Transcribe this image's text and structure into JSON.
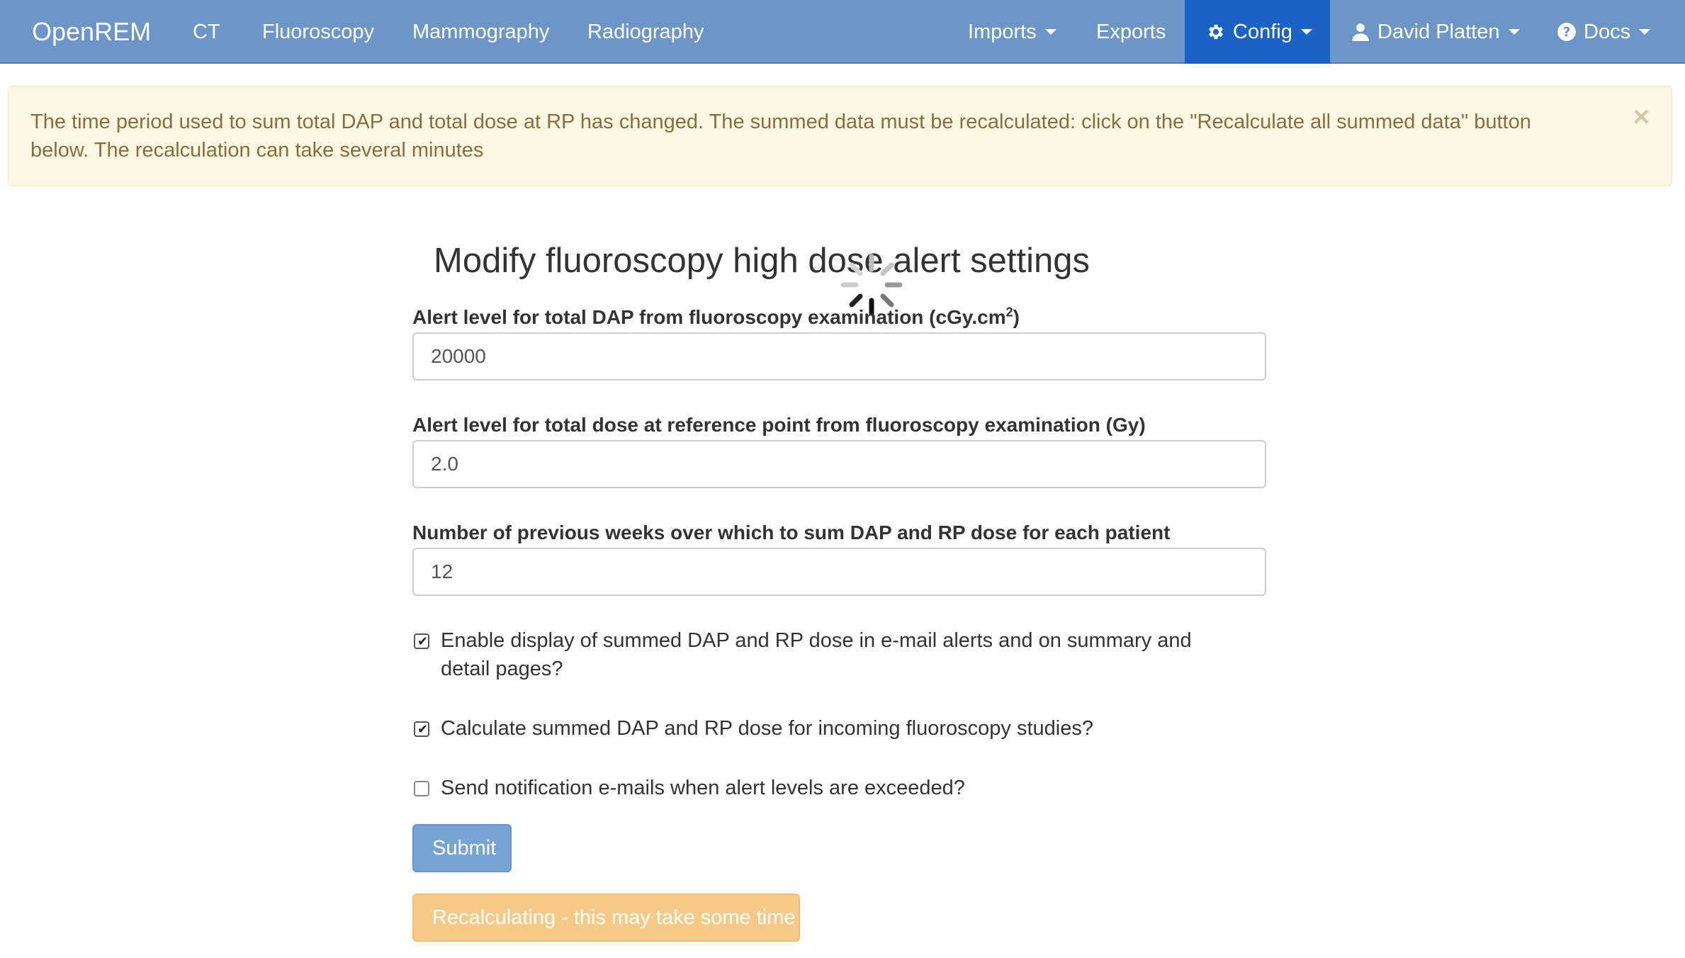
{
  "navbar": {
    "brand": "OpenREM",
    "links": {
      "ct": "CT",
      "fluoroscopy": "Fluoroscopy",
      "mammography": "Mammography",
      "radiography": "Radiography",
      "imports": "Imports",
      "exports": "Exports",
      "config": "Config",
      "user": "David Platten",
      "docs": "Docs"
    },
    "active_item": "Config",
    "colors": {
      "bar": "#6c95c8",
      "active": "#1a62c6"
    }
  },
  "alert": {
    "message": "The time period used to sum total DAP and total dose at RP has changed. The summed data must be recalculated: click on the \"Recalculate all summed data\" button below. The recalculation can take several minutes",
    "close_label": "×"
  },
  "form": {
    "title": "Modify fluoroscopy high dose alert settings",
    "dap_label": "Alert level for total DAP from fluoroscopy examination (cGy.cm",
    "dap_label_sup": "2",
    "dap_label_end": ")",
    "dap_value": "20000",
    "rp_label": "Alert level for total dose at reference point from fluoroscopy examination (Gy)",
    "rp_value": "2.0",
    "weeks_label": "Number of previous weeks over which to sum DAP and RP dose for each patient",
    "weeks_value": "12",
    "check_display": {
      "label": "Enable display of summed DAP and RP dose in e-mail alerts and on summary and detail pages?",
      "checked": true
    },
    "check_calculate": {
      "label": "Calculate summed DAP and RP dose for incoming fluoroscopy studies?",
      "checked": true
    },
    "check_notify": {
      "label": "Send notification e-mails when alert levels are exceeded?",
      "checked": false
    },
    "submit_label": "Submit",
    "recalc_label": "Recalculating - this may take some time"
  }
}
